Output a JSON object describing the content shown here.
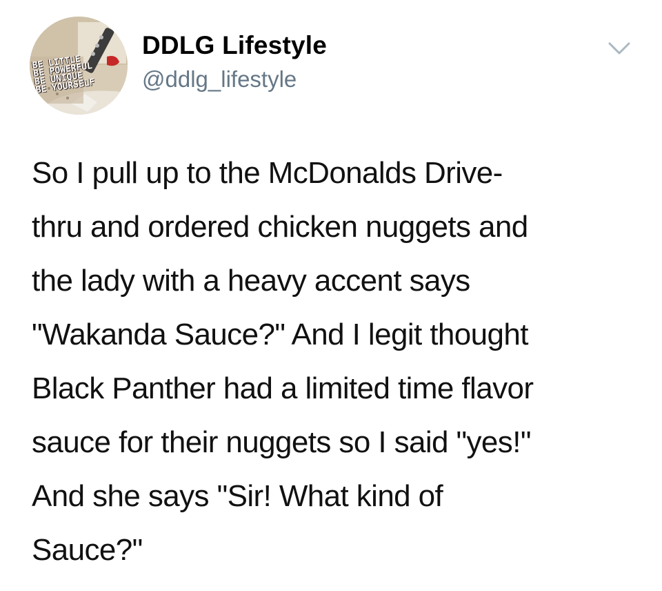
{
  "profile": {
    "display_name": "DDLG Lifestyle",
    "handle": "@ddlg_lifestyle",
    "avatar_text": "BE LITTLE\nBE POWERFUL\nBE UNIQUE\nBE YOURSELF"
  },
  "menu": {
    "icon": "chevron-down-icon"
  },
  "tweet": {
    "lines": [
      "So I pull up to the McDonalds Drive-",
      "thru and ordered chicken nuggets and",
      "the lady with a heavy accent says",
      "\"Wakanda Sauce?\" And I legit thought",
      "Black Panther had a limited time flavor",
      "sauce for their nuggets so I said \"yes!\"",
      "And she says \"Sir! What kind of",
      "Sauce?\""
    ]
  },
  "colors": {
    "handle": "#657786",
    "chevron": "#aab8c2",
    "text": "#111111"
  }
}
